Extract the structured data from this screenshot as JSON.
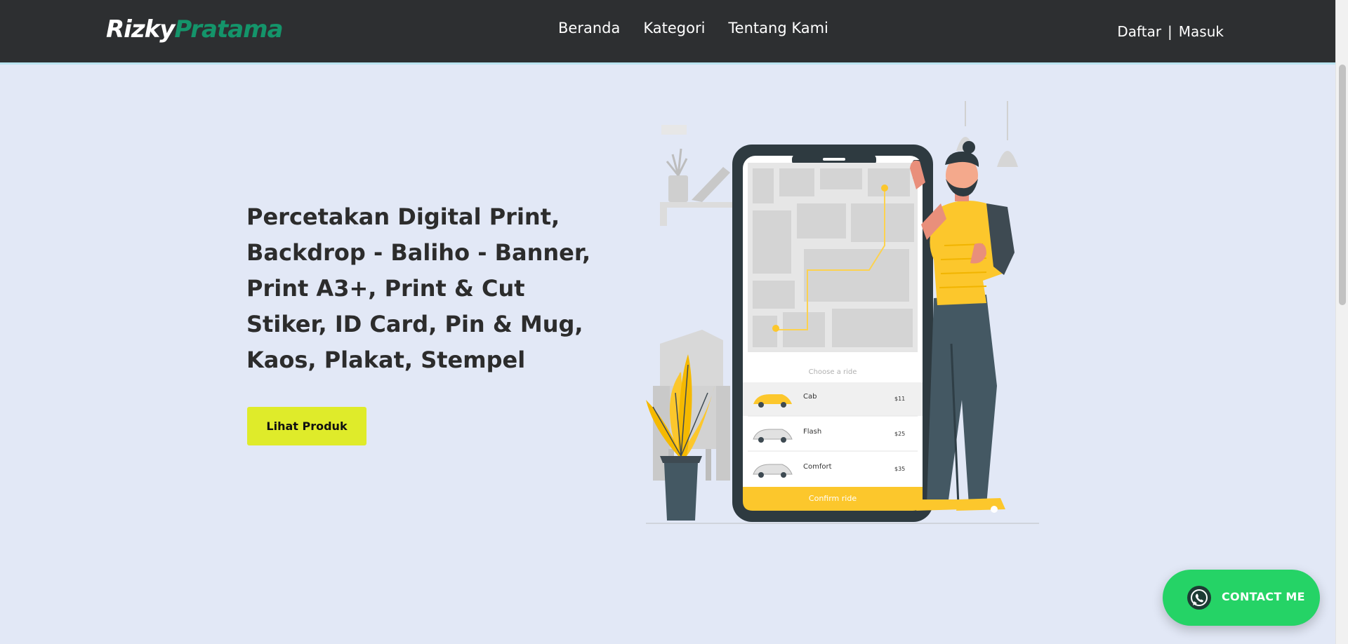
{
  "header": {
    "logo_first": "Rizky",
    "logo_last": "Pratama",
    "nav": [
      {
        "label": "Beranda"
      },
      {
        "label": "Kategori"
      },
      {
        "label": "Tentang Kami"
      }
    ],
    "auth": {
      "register": "Daftar",
      "separator": "|",
      "login": "Masuk"
    }
  },
  "hero": {
    "title": "Percetakan Digital Print, Backdrop - Baliho - Banner, Print A3+, Print & Cut Stiker, ID Card, Pin & Mug, Kaos, Plakat, Stempel",
    "button": "Lihat Produk"
  },
  "illustration": {
    "choose_ride": "Choose a ride",
    "rides": [
      {
        "name": "Cab",
        "price": "$11"
      },
      {
        "name": "Flash",
        "price": "$25"
      },
      {
        "name": "Comfort",
        "price": "$35"
      }
    ],
    "confirm": "Confirm ride"
  },
  "contact": {
    "label": "CONTACT ME",
    "icon": "whatsapp-icon"
  },
  "colors": {
    "navbar": "#2d2f31",
    "background": "#e2e8f6",
    "logo_accent": "#14946a",
    "cta": "#dfeb2a",
    "contact": "#25d366",
    "illustration_yellow": "#fcc72c",
    "illustration_slate": "#445863"
  }
}
